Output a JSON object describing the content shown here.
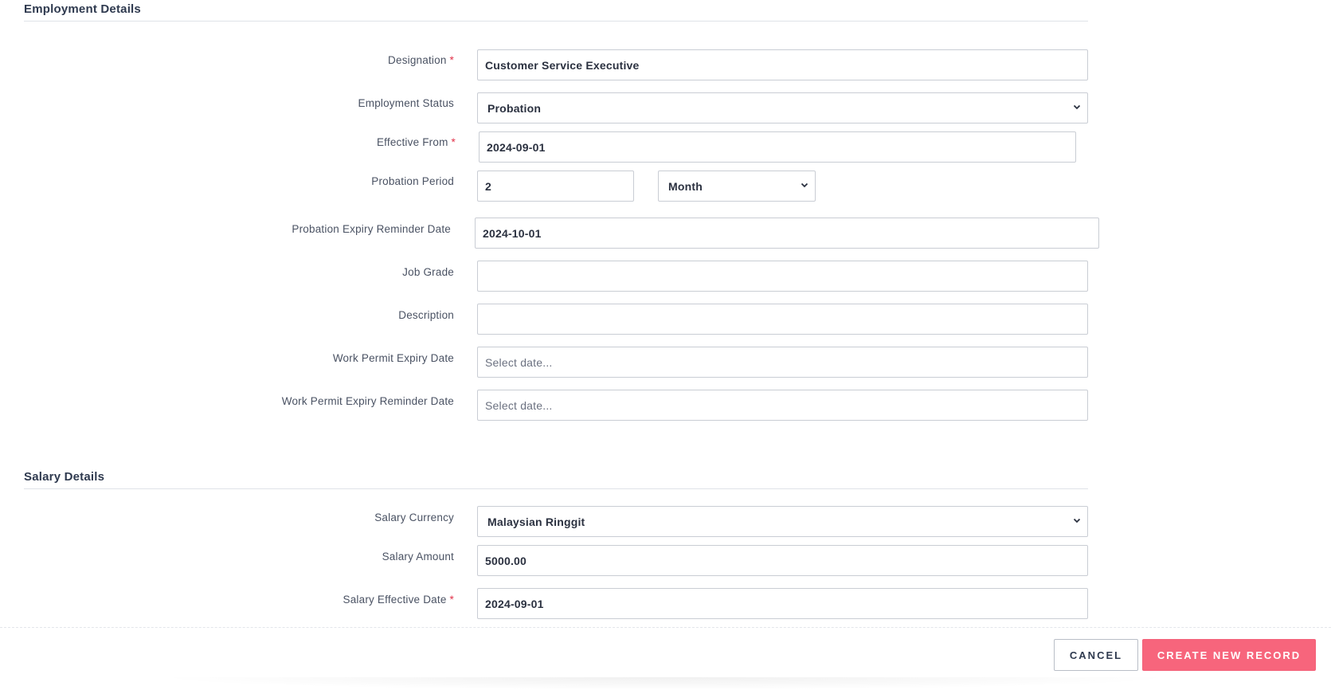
{
  "employment": {
    "title": "Employment Details",
    "designation": {
      "label": "Designation",
      "value": "Customer Service Executive"
    },
    "employment_status": {
      "label": "Employment Status",
      "value": "Probation"
    },
    "effective_from": {
      "label": "Effective From",
      "value": "2024-09-01"
    },
    "probation_period": {
      "label": "Probation Period",
      "value": "2",
      "unit": "Month"
    },
    "probation_expiry_reminder": {
      "label": "Probation Expiry Reminder Date",
      "value": "2024-10-01"
    },
    "job_grade": {
      "label": "Job Grade",
      "value": ""
    },
    "description": {
      "label": "Description",
      "value": ""
    },
    "work_permit_expiry": {
      "label": "Work Permit Expiry Date",
      "placeholder": "Select date..."
    },
    "work_permit_expiry_reminder": {
      "label": "Work Permit Expiry Reminder Date",
      "placeholder": "Select date..."
    }
  },
  "salary": {
    "title": "Salary Details",
    "currency": {
      "label": "Salary Currency",
      "value": "Malaysian Ringgit"
    },
    "amount": {
      "label": "Salary Amount",
      "value": "5000.00"
    },
    "effective_date": {
      "label": "Salary Effective Date",
      "value": "2024-09-01"
    }
  },
  "required_marker": "*",
  "footer": {
    "cancel_label": "CANCEL",
    "create_label": "CREATE NEW RECORD"
  },
  "colors": {
    "accent": "#f7657c",
    "required": "#e2334a",
    "border": "#c9cdd4"
  }
}
